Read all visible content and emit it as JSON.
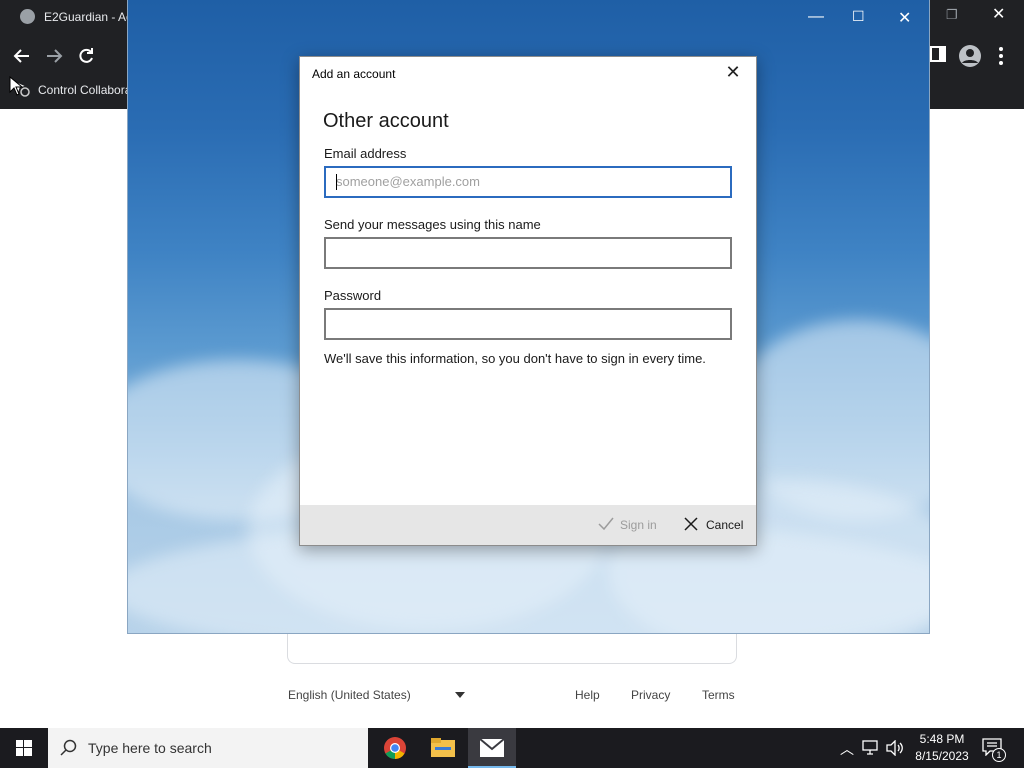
{
  "browser": {
    "tab_title": "E2Guardian - Ac",
    "bookmark_label": "Control Collabora"
  },
  "page": {
    "language": "English (United States)",
    "links": [
      "Help",
      "Privacy",
      "Terms"
    ]
  },
  "dialog": {
    "title": "Add an account",
    "heading": "Other account",
    "email_label": "Email address",
    "email_placeholder": "someone@example.com",
    "email_value": "",
    "name_label": "Send your messages using this name",
    "name_value": "",
    "password_label": "Password",
    "password_value": "",
    "info_text": "We'll save this information, so you don't have to sign in every time.",
    "sign_in_label": "Sign in",
    "cancel_label": "Cancel"
  },
  "taskbar": {
    "search_placeholder": "Type here to search",
    "time": "5:48 PM",
    "date": "8/15/2023",
    "notification_count": "1"
  },
  "colors": {
    "focus_border": "#2b6bbf",
    "taskbar_bg": "#1b1b1f",
    "browser_bg": "#202124"
  }
}
